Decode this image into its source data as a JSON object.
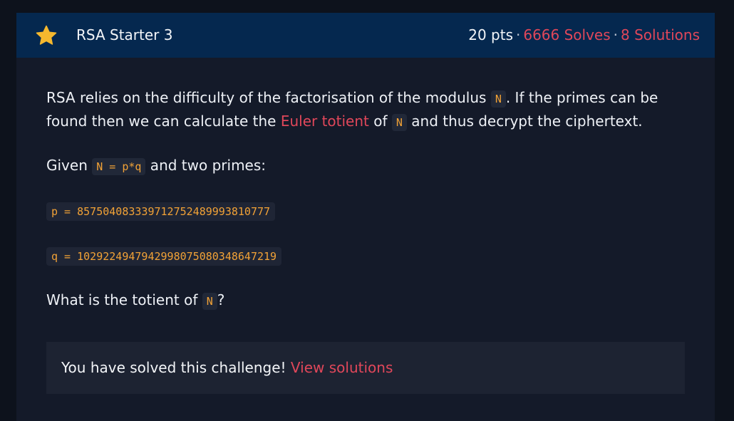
{
  "header": {
    "title": "RSA Starter 3",
    "points": "20 pts",
    "separator": "·",
    "solves": "6666 Solves",
    "solutions": "8 Solutions"
  },
  "description": {
    "p1_part1": "RSA relies on the difficulty of the factorisation of the modulus ",
    "p1_code1": "N",
    "p1_part2": ". If the primes can be",
    "p1_part3": "found then we can calculate the ",
    "p1_link": "Euler totient",
    "p1_part4": " of ",
    "p1_code2": "N",
    "p1_part5": " and thus decrypt the ciphertext.",
    "p2_part1": "Given ",
    "p2_code": "N = p*q",
    "p2_part2": " and two primes:",
    "p_value": "p = 857504083339712752489993810777",
    "q_value": "q = 1029224947942998075080348647219",
    "p3_part1": "What is the totient of ",
    "p3_code": "N",
    "p3_part2": "?"
  },
  "status": {
    "message": "You have solved this challenge! ",
    "link": "View solutions"
  },
  "colors": {
    "accent": "#e0475a",
    "code": "#f2a236",
    "header_bg": "#05284f",
    "star": "#f5b82e"
  },
  "icons": {
    "star": "star-icon"
  }
}
